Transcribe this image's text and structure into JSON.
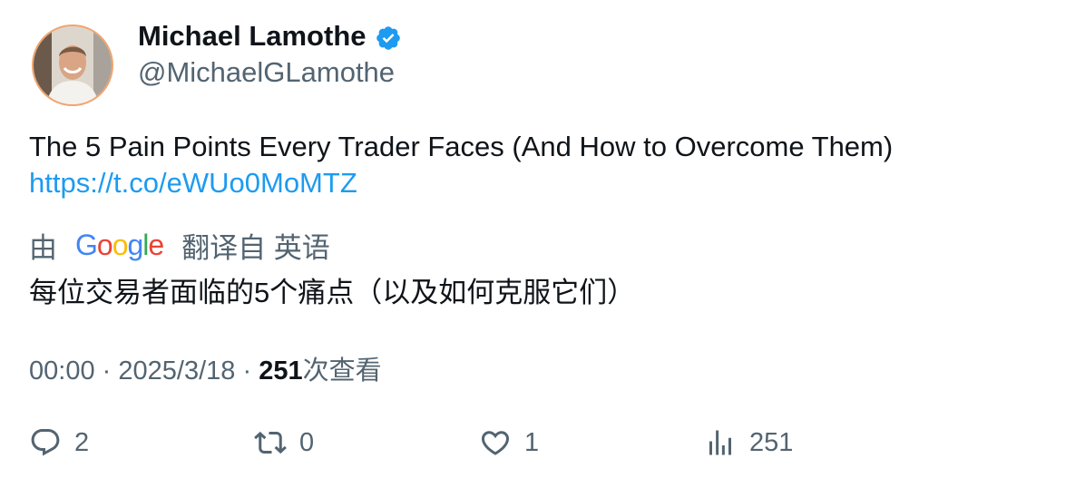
{
  "author": {
    "name": "Michael Lamothe",
    "handle": "@MichaelGLamothe"
  },
  "tweet": {
    "text": "The 5 Pain Points Every Trader Faces (And How to Overcome Them)",
    "link": "https://t.co/eWUo0MoMTZ"
  },
  "translation": {
    "prefix": "由",
    "provider_letters": [
      "G",
      "o",
      "o",
      "g",
      "l",
      "e"
    ],
    "suffix": "翻译自 英语",
    "text": "每位交易者面临的5个痛点（以及如何克服它们）"
  },
  "meta": {
    "time": "00:00",
    "sep1": "·",
    "date": "2025/3/18",
    "sep2": "·",
    "views_count": "251",
    "views_label": "次查看"
  },
  "actions": {
    "replies": "2",
    "retweets": "0",
    "likes": "1",
    "views": "251"
  },
  "colors": {
    "link": "#1d9bf0",
    "muted": "#536471",
    "verified": "#1d9bf0",
    "google": [
      "#4285F4",
      "#EA4335",
      "#FBBC05",
      "#4285F4",
      "#34A853",
      "#EA4335"
    ]
  }
}
